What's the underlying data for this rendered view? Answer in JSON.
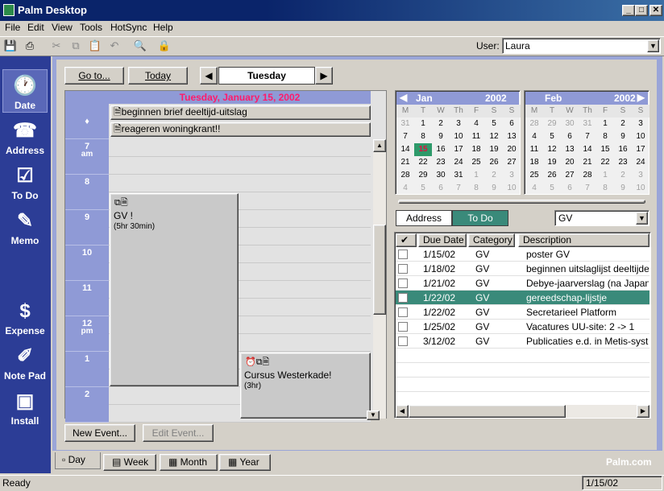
{
  "window": {
    "title": "Palm Desktop"
  },
  "menu": [
    "File",
    "Edit",
    "View",
    "Tools",
    "HotSync",
    "Help"
  ],
  "user": {
    "label": "User:",
    "value": "Laura"
  },
  "launcher": [
    {
      "label": "Date",
      "icon": "🕐"
    },
    {
      "label": "Address",
      "icon": "☎"
    },
    {
      "label": "To Do",
      "icon": "☑"
    },
    {
      "label": "Memo",
      "icon": "✎"
    },
    {
      "label": "Expense",
      "icon": "$"
    },
    {
      "label": "Note Pad",
      "icon": "✐"
    },
    {
      "label": "Install",
      "icon": "▣"
    }
  ],
  "nav": {
    "goto": "Go to...",
    "today": "Today",
    "day": "Tuesday"
  },
  "date_header": "Tuesday, January 15, 2002",
  "untimed": [
    "beginnen brief deeltijd-uitslag",
    "reageren woningkrant!!"
  ],
  "hours": [
    {
      "h": "7",
      "s": "am"
    },
    {
      "h": "8",
      "s": ""
    },
    {
      "h": "9",
      "s": ""
    },
    {
      "h": "10",
      "s": ""
    },
    {
      "h": "11",
      "s": ""
    },
    {
      "h": "12",
      "s": "pm"
    },
    {
      "h": "1",
      "s": ""
    },
    {
      "h": "2",
      "s": ""
    }
  ],
  "events": [
    {
      "title": "GV !",
      "duration": "(5hr 30min)"
    },
    {
      "title": "Cursus Westerkade!",
      "duration": "(3hr)"
    }
  ],
  "buttons": {
    "new_event": "New Event...",
    "edit_event": "Edit Event..."
  },
  "views": [
    "Day",
    "Week",
    "Month",
    "Year"
  ],
  "brand": "Palm.com",
  "calendars": [
    {
      "month": "Jan",
      "year": "2002",
      "dow": [
        "M",
        "T",
        "W",
        "Th",
        "F",
        "S",
        "S"
      ],
      "days": [
        "31",
        "1",
        "2",
        "3",
        "4",
        "5",
        "6",
        "7",
        "8",
        "9",
        "10",
        "11",
        "12",
        "13",
        "14",
        "15",
        "16",
        "17",
        "18",
        "19",
        "20",
        "21",
        "22",
        "23",
        "24",
        "25",
        "26",
        "27",
        "28",
        "29",
        "30",
        "31",
        "1",
        "2",
        "3",
        "4",
        "5",
        "6",
        "7",
        "8",
        "9",
        "10"
      ],
      "today_index": 15
    },
    {
      "month": "Feb",
      "year": "2002",
      "dow": [
        "M",
        "T",
        "W",
        "Th",
        "F",
        "S",
        "S"
      ],
      "days": [
        "28",
        "29",
        "30",
        "31",
        "1",
        "2",
        "3",
        "4",
        "5",
        "6",
        "7",
        "8",
        "9",
        "10",
        "11",
        "12",
        "13",
        "14",
        "15",
        "16",
        "17",
        "18",
        "19",
        "20",
        "21",
        "22",
        "23",
        "24",
        "25",
        "26",
        "27",
        "28",
        "1",
        "2",
        "3",
        "4",
        "5",
        "6",
        "7",
        "8",
        "9",
        "10"
      ]
    }
  ],
  "pane_tabs": {
    "address": "Address",
    "todo": "To Do"
  },
  "category_filter": "GV",
  "todo": {
    "columns": [
      "✔",
      "Due Date",
      "Category",
      "Description"
    ],
    "rows": [
      {
        "due": "1/15/02",
        "cat": "GV",
        "desc": "poster GV"
      },
      {
        "due": "1/18/02",
        "cat": "GV",
        "desc": "beginnen uitslaglijst deeltijders"
      },
      {
        "due": "1/21/02",
        "cat": "GV",
        "desc": "Debye-jaarverslag (na Japan)"
      },
      {
        "due": "1/22/02",
        "cat": "GV",
        "desc": "gereedschap-lijstje"
      },
      {
        "due": "1/22/02",
        "cat": "GV",
        "desc": "Secretarieel Platform"
      },
      {
        "due": "1/25/02",
        "cat": "GV",
        "desc": "Vacatures UU-site: 2 -> 1"
      },
      {
        "due": "3/12/02",
        "cat": "GV",
        "desc": "Publicaties e.d. in Metis-systeem"
      }
    ],
    "selected": 3
  },
  "status": {
    "left": "Ready",
    "right": "1/15/02"
  }
}
